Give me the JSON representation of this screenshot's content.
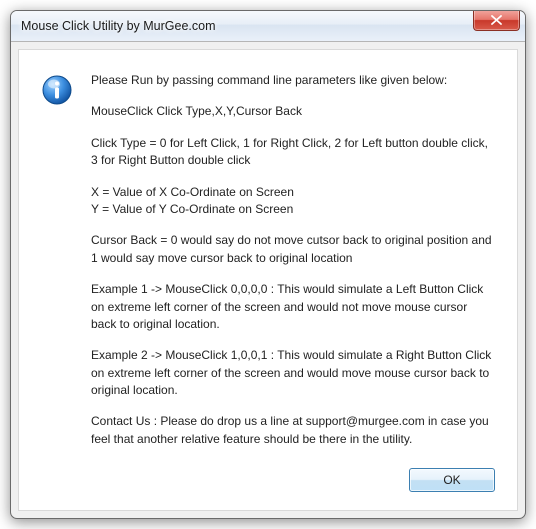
{
  "window": {
    "title": "Mouse Click Utility by MurGee.com"
  },
  "message": {
    "intro": "Please Run by passing command line parameters like given below:",
    "syntax": "MouseClick Click Type,X,Y,Cursor Back",
    "click_type": "Click Type = 0 for Left Click, 1 for Right Click, 2 for Left button double click, 3 for Right Button double click",
    "x_desc": "X = Value of X Co-Ordinate on Screen",
    "y_desc": "Y = Value of Y Co-Ordinate on Screen",
    "cursor_back": "Cursor Back = 0 would say do not move cutsor back to original position and 1 would say move cursor back to original location",
    "example1": "Example 1 -> MouseClick 0,0,0,0 : This would simulate a Left Button Click on extreme left corner of the screen and would not move mouse cursor back to original location.",
    "example2": "Example 2 -> MouseClick 1,0,0,1 : This would simulate a Right Button Click on extreme left corner of the screen and would move mouse cursor back to original location.",
    "contact": "Contact Us : Please do drop us a line at support@murgee.com in case you feel that another relative feature should be there in the utility."
  },
  "buttons": {
    "ok": "OK"
  }
}
